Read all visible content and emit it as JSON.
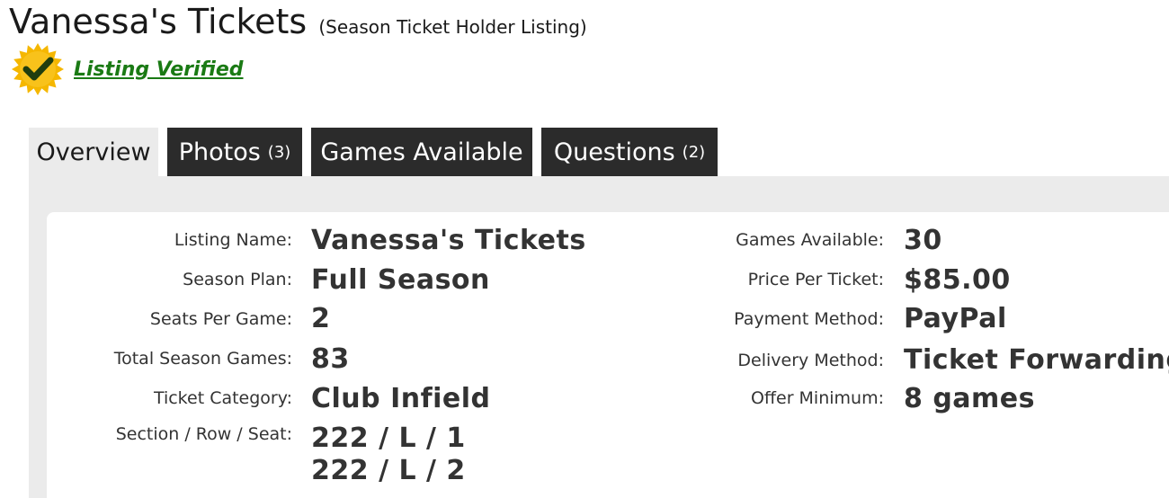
{
  "header": {
    "title": "Vanessa's Tickets",
    "subtitle": "(Season Ticket Holder Listing)",
    "verified_label": "Listing Verified"
  },
  "tabs": [
    {
      "label": "Overview",
      "count": ""
    },
    {
      "label": "Photos",
      "count": "(3)"
    },
    {
      "label": "Games Available",
      "count": ""
    },
    {
      "label": "Questions",
      "count": "(2)"
    }
  ],
  "details_left": [
    {
      "label": "Listing Name:",
      "value": "Vanessa's Tickets"
    },
    {
      "label": "Season Plan:",
      "value": "Full Season"
    },
    {
      "label": "Seats Per Game:",
      "value": "2"
    },
    {
      "label": "Total Season Games:",
      "value": "83"
    },
    {
      "label": "Ticket Category:",
      "value": "Club Infield"
    },
    {
      "label": "Section / Row / Seat:",
      "value": "222 / L / 1",
      "value2": "222 / L / 2"
    }
  ],
  "details_right": [
    {
      "label": "Games Available:",
      "value": "30"
    },
    {
      "label": "Price Per Ticket:",
      "value": "$85.00"
    },
    {
      "label": "Payment Method:",
      "value": "PayPal"
    },
    {
      "label": "Delivery Method:",
      "value": "Ticket Forwarding"
    },
    {
      "label": "Offer Minimum:",
      "value": "8 games"
    }
  ],
  "colors": {
    "tab_dark": "#2b2b2b",
    "panel_bg": "#ebebeb",
    "verified_green": "#1a7a14",
    "badge_gold": "#f5b700"
  },
  "icons": {
    "verified_badge": "verified-badge-icon"
  }
}
